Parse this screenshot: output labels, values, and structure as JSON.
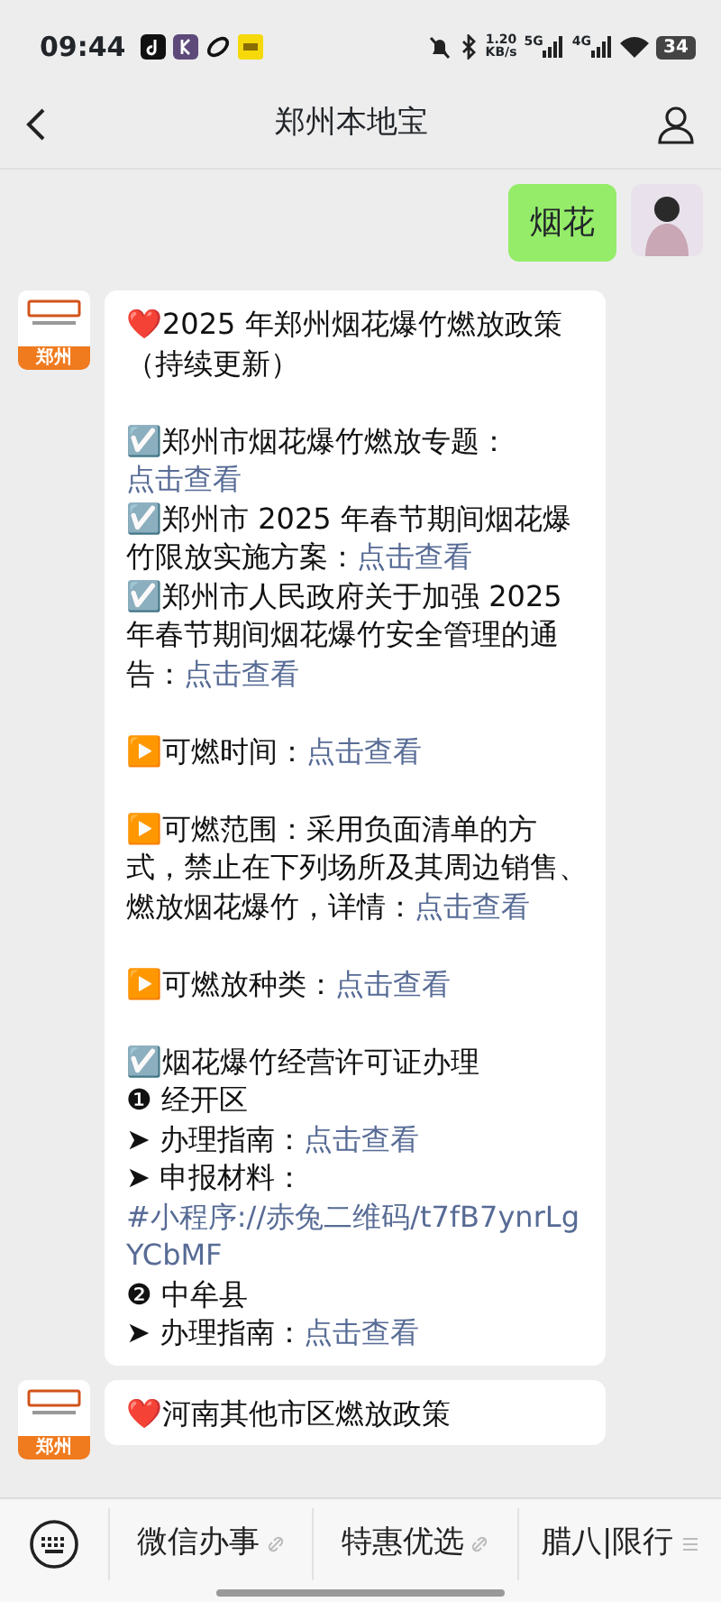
{
  "status_bar": {
    "time": "09:44",
    "speed_value": "1.20",
    "speed_unit": "KB/s",
    "networks": [
      "5G",
      "4G"
    ],
    "battery": "34"
  },
  "header": {
    "title": "郑州本地宝"
  },
  "messages": [
    {
      "kind": "sent",
      "text": "烟花"
    },
    {
      "kind": "received",
      "avatar_label": "郑州",
      "paragraphs": [
        [
          {
            "text": "❤️2025 年郑州烟花爆竹燃放政策（持续更新）"
          }
        ],
        [
          {
            "text": "☑️郑州市烟花爆竹燃放专题：",
            "link": "点击查看"
          },
          {
            "text": "☑️郑州市 2025 年春节期间烟花爆竹限放实施方案：",
            "link": "点击查看"
          },
          {
            "text": "☑️郑州市人民政府关于加强 2025 年春节期间烟花爆竹安全管理的通告：",
            "link": "点击查看"
          }
        ],
        [
          {
            "text": "▶️可燃时间：",
            "link": "点击查看"
          }
        ],
        [
          {
            "text": "▶️可燃范围：采用负面清单的方式，禁止在下列场所及其周边销售、燃放烟花爆竹，详情：",
            "link": "点击查看"
          }
        ],
        [
          {
            "text": "▶️可燃放种类：",
            "link": "点击查看"
          }
        ],
        [
          {
            "text": "☑️烟花爆竹经营许可证办理"
          },
          {
            "text": "❶ 经开区"
          },
          {
            "text": "➤ 办理指南：",
            "link": "点击查看"
          },
          {
            "text": "➤ 申报材料：",
            "link": "#小程序://赤兔二维码/t7fB7ynrLgYCbMF"
          },
          {
            "text": "❷ 中牟县"
          },
          {
            "text": "➤ 办理指南：",
            "link": "点击查看"
          }
        ]
      ]
    },
    {
      "kind": "received",
      "avatar_label": "郑州",
      "paragraphs": [
        [
          {
            "text": "❤️河南其他市区燃放政策"
          }
        ]
      ]
    }
  ],
  "menu": [
    {
      "label": "微信办事",
      "kind": "link"
    },
    {
      "label": "特惠优选",
      "kind": "link"
    },
    {
      "label": "腊八|限行",
      "kind": "list"
    }
  ]
}
